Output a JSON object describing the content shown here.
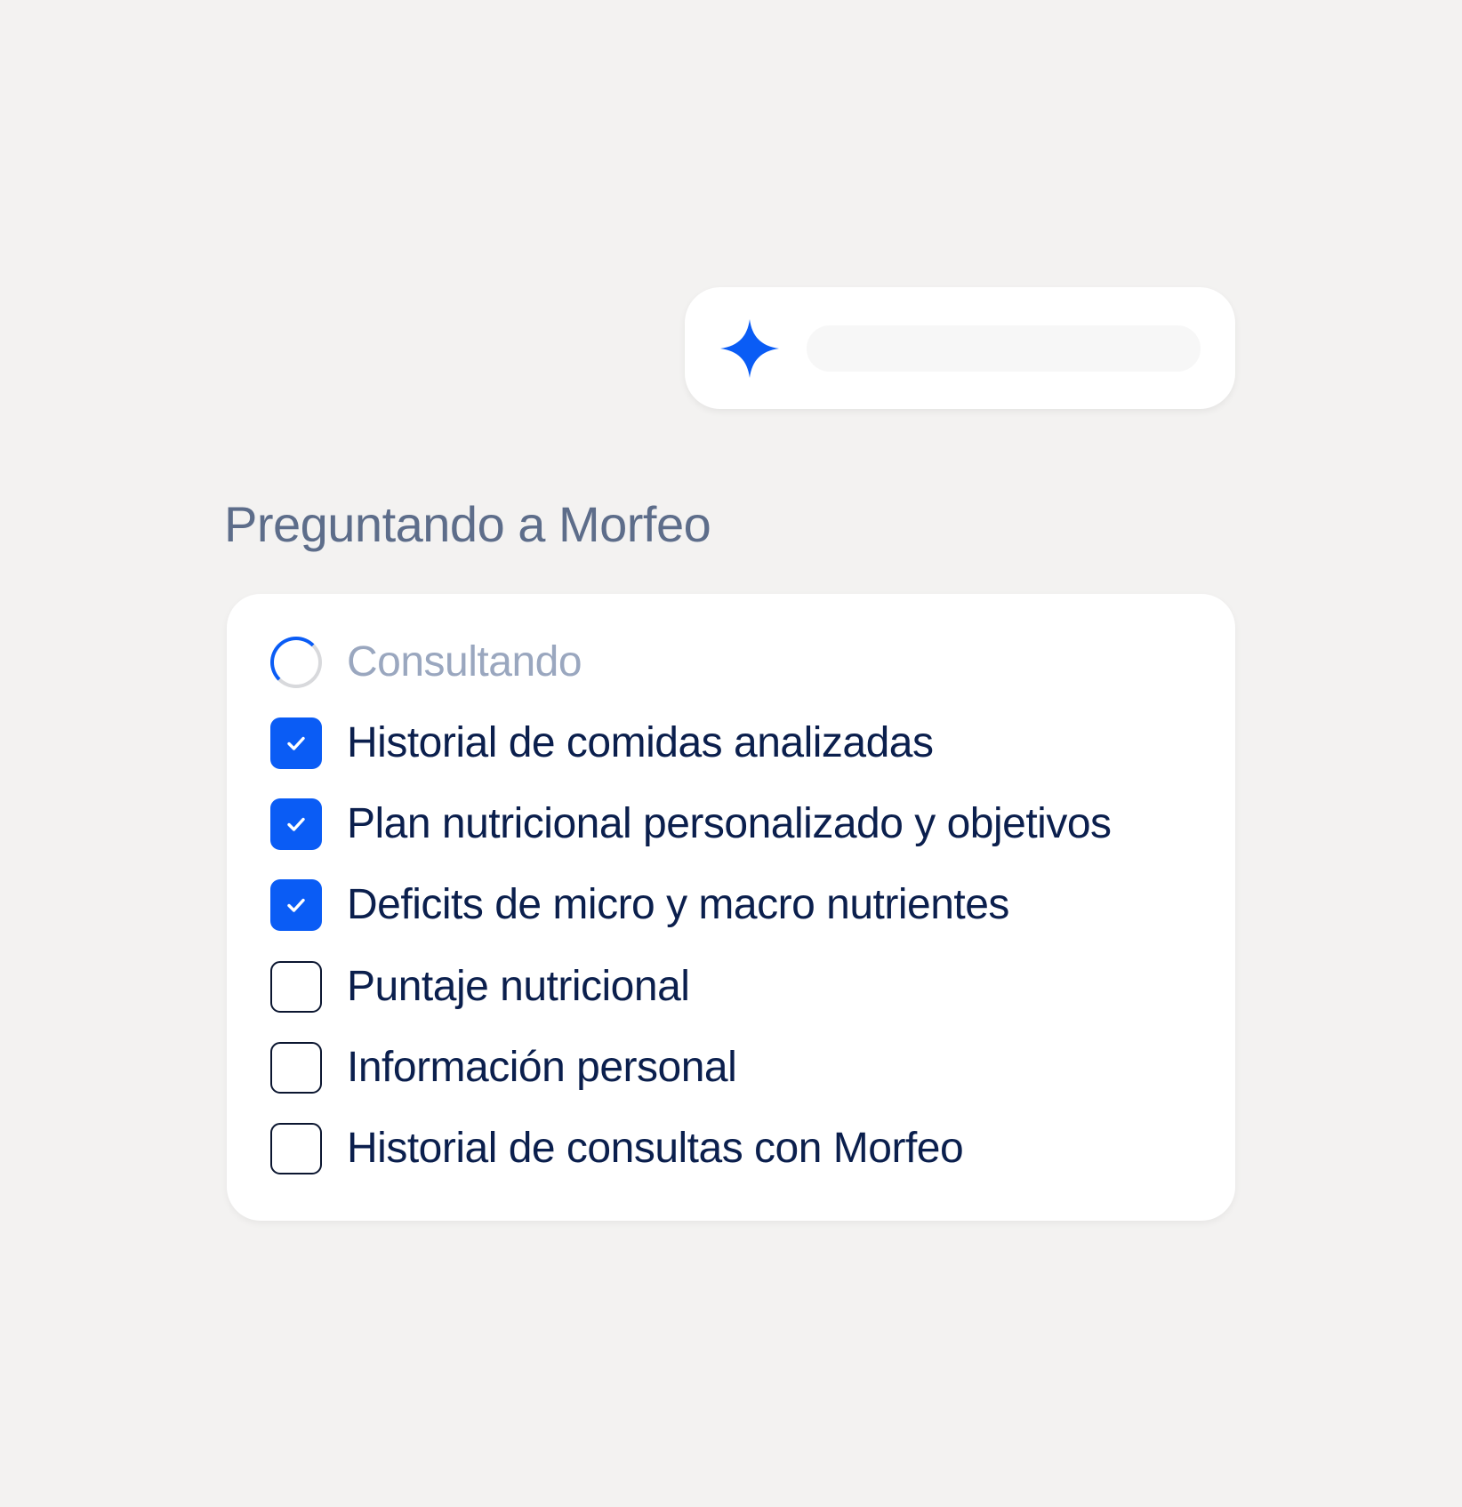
{
  "query": {
    "icon": "sparkle-icon",
    "accent_color": "#0a5cf5"
  },
  "section_title": "Preguntando a Morfeo",
  "status": {
    "label": "Consultando",
    "icon": "loading-spinner-icon"
  },
  "checklist": [
    {
      "label": "Historial de comidas analizadas",
      "checked": true
    },
    {
      "label": "Plan nutricional personalizado y objetivos",
      "checked": true
    },
    {
      "label": "Deficits de micro y macro nutrientes",
      "checked": true
    },
    {
      "label": "Puntaje nutricional",
      "checked": false
    },
    {
      "label": "Información personal",
      "checked": false
    },
    {
      "label": "Historial de consultas con Morfeo",
      "checked": false
    }
  ]
}
